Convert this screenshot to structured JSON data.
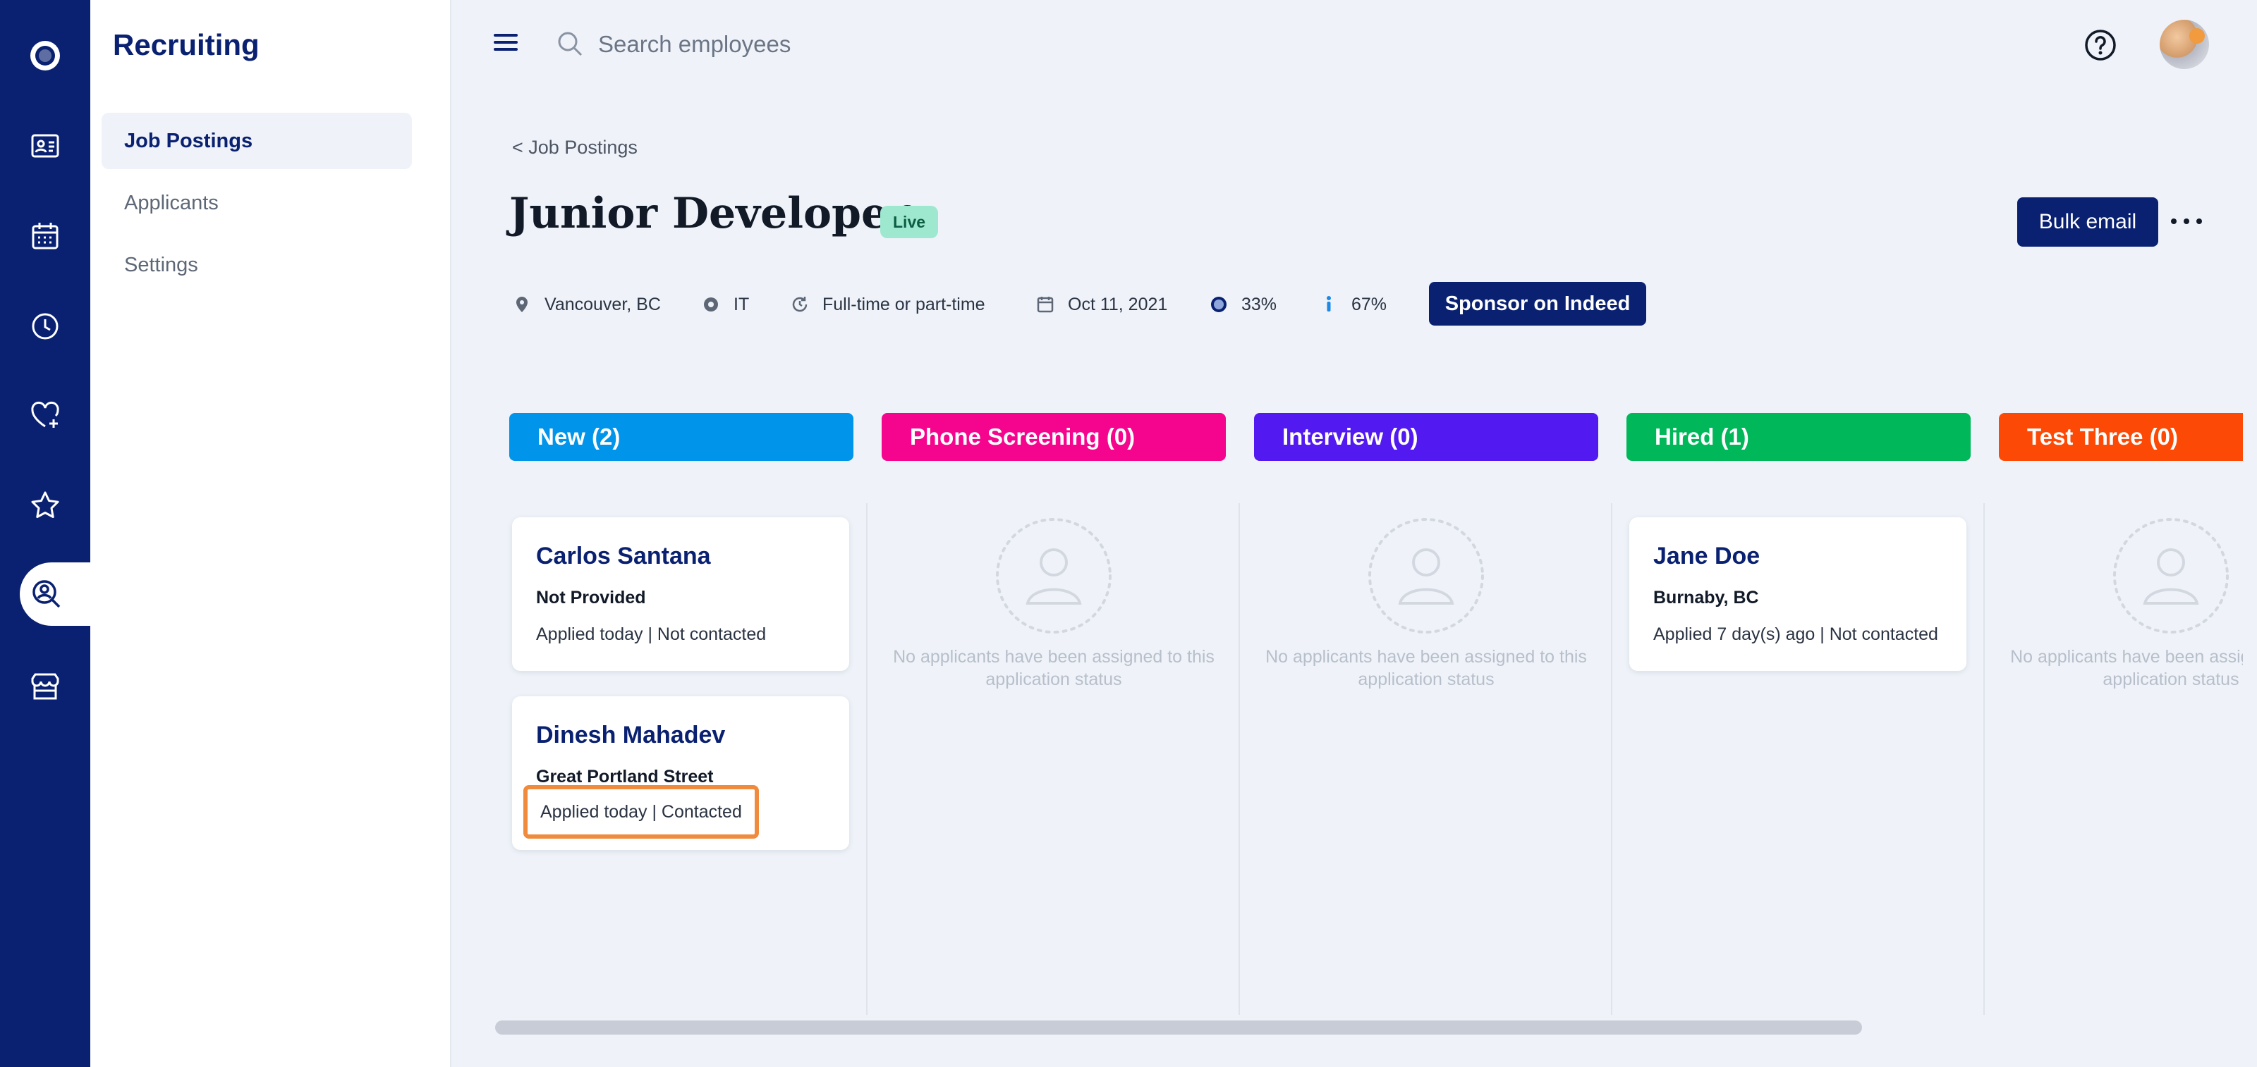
{
  "app": {
    "section_title": "Recruiting"
  },
  "rail": {
    "items": [
      {
        "name": "logo-icon"
      },
      {
        "name": "employee-directory-icon"
      },
      {
        "name": "calendar-icon"
      },
      {
        "name": "clock-icon"
      },
      {
        "name": "heart-plus-icon"
      },
      {
        "name": "star-icon"
      },
      {
        "name": "recruiting-search-icon",
        "active": true
      },
      {
        "name": "store-icon"
      }
    ]
  },
  "subnav": {
    "items": [
      {
        "label": "Job Postings",
        "active": true
      },
      {
        "label": "Applicants"
      },
      {
        "label": "Settings"
      }
    ]
  },
  "topbar": {
    "search_placeholder": "Search employees"
  },
  "header": {
    "breadcrumb": "< Job Postings",
    "title": "Junior Developer",
    "status": "Live",
    "bulk_email": "Bulk email"
  },
  "meta": {
    "location": "Vancouver, BC",
    "department": "IT",
    "employment_type": "Full-time or part-time",
    "date": "Oct 11, 2021",
    "stat1": "33%",
    "stat2": "67%",
    "sponsor_label": "Sponsor on Indeed"
  },
  "stages": [
    {
      "label": "New (2)",
      "color": "#0094ea"
    },
    {
      "label": "Phone Screening (0)",
      "color": "#f5058d"
    },
    {
      "label": "Interview (0)",
      "color": "#5219f0"
    },
    {
      "label": "Hired (1)",
      "color": "#00b859"
    },
    {
      "label": "Test Three (0)",
      "color": "#fc4a06"
    }
  ],
  "cards": [
    {
      "name": "Carlos Santana",
      "location": "Not Provided",
      "status": "Applied today | Not contacted"
    },
    {
      "name": "Dinesh Mahadev",
      "location": "Great Portland Street",
      "status": "Applied today | Contacted"
    },
    {
      "name": "Jane Doe",
      "location": "Burnaby, BC",
      "status": "Applied 7 day(s) ago | Not contacted"
    }
  ],
  "empty_state": {
    "text": "No applicants have been assigned to this application status"
  },
  "colors": {
    "primary": "#0a2171",
    "highlight": "#f08a3c",
    "live_badge": "#9ee8d0"
  }
}
